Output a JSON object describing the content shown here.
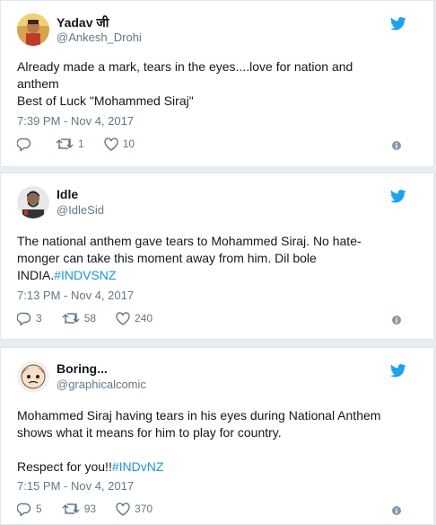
{
  "tweets": [
    {
      "name": "Yadav जी",
      "handle": "@Ankesh_Drohi",
      "lines": [
        "Already made a mark, tears in the eyes....love for nation and",
        "anthem",
        "Best of Luck \"Mohammed Siraj\""
      ],
      "time": "7:39 PM - Nov 4, 2017",
      "replies": "",
      "retweets": "1",
      "likes": "10"
    },
    {
      "name": "Idle",
      "handle": "@IdleSid",
      "lines": [
        "The national anthem gave tears to Mohammed Siraj. No hate-",
        "monger can take this moment away from him. Dil bole",
        "INDIA."
      ],
      "hashtag": "#INDVSNZ",
      "time": "7:13 PM - Nov 4, 2017",
      "replies": "3",
      "retweets": "58",
      "likes": "240"
    },
    {
      "name": "Boring...",
      "handle": "@graphicalcomic",
      "lines": [
        "Mohammed Siraj having tears in his eyes during National Anthem",
        "shows what it means for him to play for country.",
        "",
        "Respect for you!!"
      ],
      "hashtag": "#INDvNZ",
      "time": "7:15 PM - Nov 4, 2017",
      "replies": "5",
      "retweets": "93",
      "likes": "370"
    }
  ],
  "colors": {
    "twitter_blue": "#1da1f2",
    "link_blue": "#1b95e0",
    "muted": "#657786",
    "background": "#e6ecf0"
  },
  "icons": [
    "avatar",
    "twitter-bird-icon",
    "reply-icon",
    "retweet-icon",
    "like-icon",
    "info-icon"
  ]
}
